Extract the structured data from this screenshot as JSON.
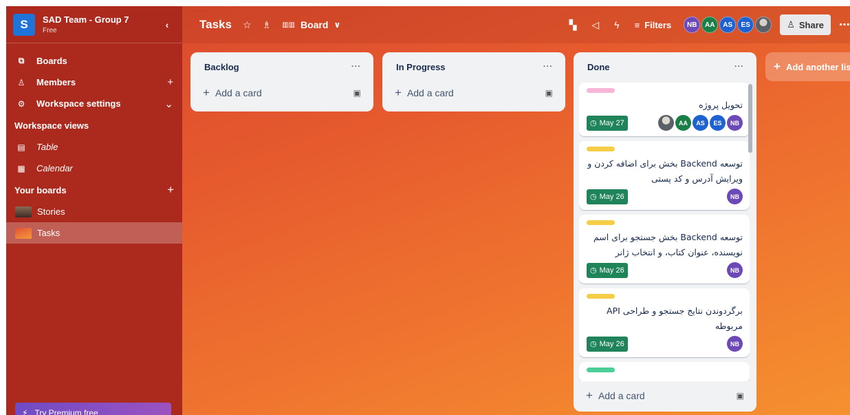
{
  "workspace": {
    "initial": "S",
    "name": "SAD Team - Group 7",
    "plan": "Free",
    "collapse_glyph": "‹"
  },
  "nav": [
    {
      "label": "Boards",
      "icon": "⧉",
      "trail": ""
    },
    {
      "label": "Members",
      "icon": "♙",
      "trail": "+"
    },
    {
      "label": "Workspace settings",
      "icon": "⚙",
      "trail": "⌄"
    }
  ],
  "views_title": "Workspace views",
  "views": [
    {
      "label": "Table",
      "icon": "▤"
    },
    {
      "label": "Calendar",
      "icon": "▦"
    }
  ],
  "boards_title": "Your boards",
  "boards_add": "+",
  "boards": [
    {
      "label": "Stories",
      "thumb_color": "#6b4a3a"
    },
    {
      "label": "Tasks",
      "thumb_color": "#e8733a"
    }
  ],
  "premium": {
    "label": "Try Premium free",
    "icon": "⚡"
  },
  "topbar": {
    "board_title": "Tasks",
    "view_label": "Board",
    "filters_label": "Filters",
    "share_label": "Share",
    "avatars": [
      {
        "initials": "NB",
        "color": "#6d49b8"
      },
      {
        "initials": "AA",
        "color": "#1a7f46"
      },
      {
        "initials": "AS",
        "color": "#1e62d0"
      },
      {
        "initials": "ES",
        "color": "#1e62d0"
      },
      {
        "initials": "",
        "color": "#8a8f99"
      }
    ]
  },
  "lists": [
    {
      "title": "Backlog",
      "add_label": "Add a card"
    },
    {
      "title": "In Progress",
      "add_label": "Add a card"
    },
    {
      "title": "Done",
      "add_label": "Add a card",
      "cards": [
        {
          "label_color": "#f7b6d8",
          "title": "تحویل پروژه",
          "due": "May 27",
          "members": [
            {
              "initials": "",
              "color": "#8a8f99"
            },
            {
              "initials": "AA",
              "color": "#1a7f46"
            },
            {
              "initials": "AS",
              "color": "#1e62d0"
            },
            {
              "initials": "ES",
              "color": "#1e62d0"
            },
            {
              "initials": "NB",
              "color": "#6d49b8"
            }
          ]
        },
        {
          "label_color": "#f5cd47",
          "title": "توسعه Backend بخش برای اضافه کردن و ویرایش آدرس و کد پستی",
          "due": "May 26",
          "members": [
            {
              "initials": "NB",
              "color": "#6d49b8"
            }
          ]
        },
        {
          "label_color": "#f5cd47",
          "title": "توسعه Backend بخش جستجو برای اسم نویسنده، عنوان کتاب، و انتخاب ژانر",
          "due": "May 26",
          "members": [
            {
              "initials": "NB",
              "color": "#6d49b8"
            }
          ]
        },
        {
          "label_color": "#f5cd47",
          "title": "برگردوندن نتایج جستجو و طراحی API مربوطه",
          "due": "May 26",
          "members": [
            {
              "initials": "NB",
              "color": "#6d49b8"
            }
          ]
        },
        {
          "label_color": "#4bce97",
          "title": "",
          "due": "",
          "members": []
        }
      ]
    }
  ],
  "add_list_label": "Add another list"
}
